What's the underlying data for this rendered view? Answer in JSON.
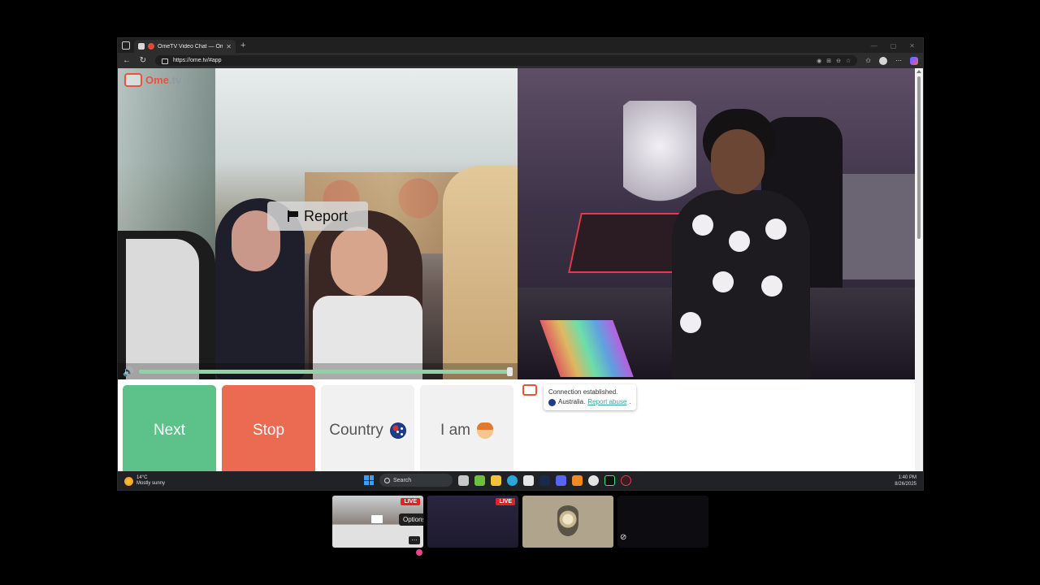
{
  "browser": {
    "tab_title": "OmeTV Video Chat — Ome.",
    "new_tab_symbol": "+",
    "url": "https://ome.tv/#app"
  },
  "site": {
    "logo_text": "Ome",
    "logo_suffix": ".tv"
  },
  "video": {
    "report_label": "Report",
    "volume_percent": 100
  },
  "controls": {
    "next_label": "Next",
    "stop_label": "Stop",
    "country_label": "Country",
    "iam_label": "I am"
  },
  "chat": {
    "status": "Connection established.",
    "country": "Australia.",
    "report_abuse": "Report abuse",
    "report_abuse_suffix": "."
  },
  "taskbar": {
    "temperature": "14°C",
    "weather": "Mostly sunny",
    "search_label": "Search",
    "time": "1:40 PM",
    "date": "8/26/2025"
  },
  "thumbnails": {
    "live_badge": "LIVE",
    "options_label": "Options"
  },
  "colors": {
    "next": "#5cc28a",
    "stop": "#ea6b52",
    "brand": "#e4553a",
    "live": "#e02424"
  }
}
